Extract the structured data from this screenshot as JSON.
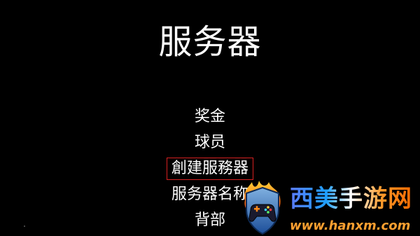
{
  "screen": {
    "title": "服务器"
  },
  "menu": {
    "items": [
      {
        "label": "奖金",
        "selected": false
      },
      {
        "label": "球员",
        "selected": false
      },
      {
        "label": "創建服務器",
        "selected": true
      },
      {
        "label": "服务器名称",
        "selected": false
      },
      {
        "label": "背部",
        "selected": false
      }
    ]
  },
  "colors": {
    "background": "#000000",
    "text": "#ffffff",
    "selection_border": "#d62020"
  },
  "watermark": {
    "brand": "西美手游网",
    "url": "www.hanxm.com",
    "icon": "gamepad-shield-icon"
  }
}
